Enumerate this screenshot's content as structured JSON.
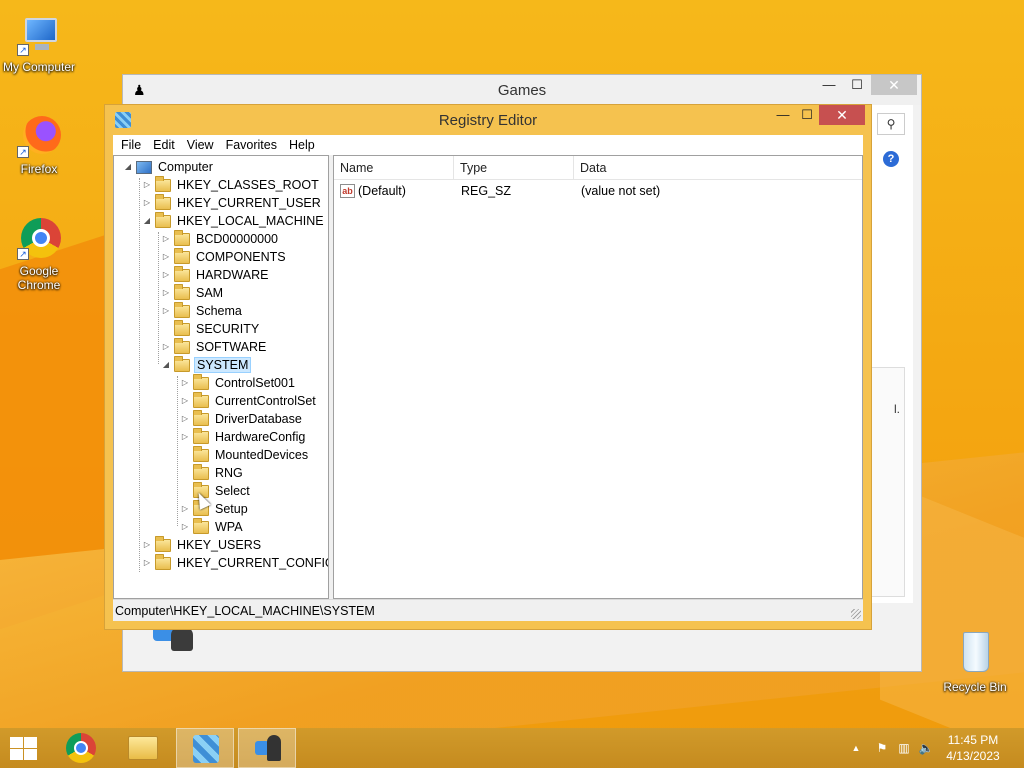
{
  "desktop": {
    "icons": [
      {
        "label": "My Computer"
      },
      {
        "label": "Firefox"
      },
      {
        "label": "Google Chrome"
      },
      {
        "label": "Recycle Bin"
      }
    ]
  },
  "games_window": {
    "title": "Games",
    "minimize": "—",
    "maximize": "☐",
    "close": "✕",
    "search_icon": "⚲",
    "help": "?",
    "panel_text": "l."
  },
  "regedit": {
    "title": "Registry Editor",
    "minimize": "—",
    "maximize": "☐",
    "close": "✕",
    "menu": [
      "File",
      "Edit",
      "View",
      "Favorites",
      "Help"
    ],
    "tree": {
      "root": "Computer",
      "hives": [
        "HKEY_CLASSES_ROOT",
        "HKEY_CURRENT_USER",
        "HKEY_LOCAL_MACHINE"
      ],
      "hklm_children": [
        "BCD00000000",
        "COMPONENTS",
        "HARDWARE",
        "SAM",
        "Schema",
        "SECURITY",
        "SOFTWARE",
        "SYSTEM"
      ],
      "system_children": [
        "ControlSet001",
        "CurrentControlSet",
        "DriverDatabase",
        "HardwareConfig",
        "MountedDevices",
        "RNG",
        "Select",
        "Setup",
        "WPA"
      ],
      "more_hives": [
        "HKEY_USERS",
        "HKEY_CURRENT_CONFIG"
      ],
      "selected": "SYSTEM"
    },
    "columns": [
      "Name",
      "Type",
      "Data"
    ],
    "values": [
      {
        "name": "(Default)",
        "type": "REG_SZ",
        "data": "(value not set)"
      }
    ],
    "status_path": "Computer\\HKEY_LOCAL_MACHINE\\SYSTEM"
  },
  "taskbar": {
    "tray_chevron": "▲",
    "time": "11:45 PM",
    "date": "4/13/2023"
  }
}
